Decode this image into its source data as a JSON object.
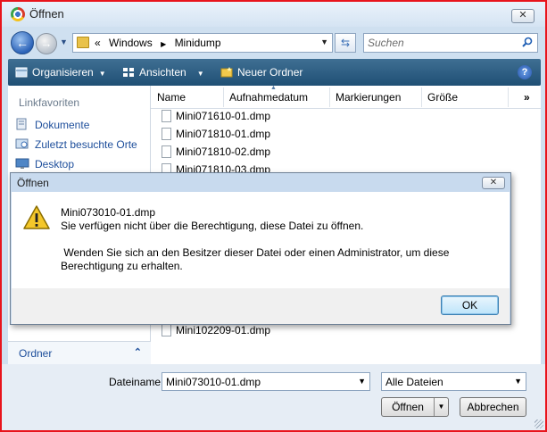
{
  "window": {
    "title": "Öffnen"
  },
  "nav": {
    "breadcrumb": [
      "«",
      "Windows",
      "Minidump"
    ],
    "search_placeholder": "Suchen"
  },
  "toolbar": {
    "organize": "Organisieren",
    "views": "Ansichten",
    "new_folder": "Neuer Ordner"
  },
  "sidebar": {
    "heading": "Linkfavoriten",
    "items": [
      {
        "label": "Dokumente"
      },
      {
        "label": "Zuletzt besuchte Orte"
      },
      {
        "label": "Desktop"
      }
    ],
    "folders_label": "Ordner"
  },
  "columns": [
    "Name",
    "Aufnahmedatum",
    "Markierungen",
    "Größe"
  ],
  "more_columns": "»",
  "files": [
    "Mini071610-01.dmp",
    "Mini071810-01.dmp",
    "Mini071810-02.dmp",
    "Mini071810-03.dmp",
    "Mini102209-01.dmp"
  ],
  "bottom": {
    "filename_label": "Dateiname:",
    "filename_value": "Mini073010-01.dmp",
    "filetype_value": "Alle Dateien",
    "open_label": "Öffnen",
    "cancel_label": "Abbrechen"
  },
  "dialog": {
    "title": "Öffnen",
    "filename": "Mini073010-01.dmp",
    "message_line1": "Sie verfügen nicht über die Berechtigung, diese Datei zu öffnen.",
    "message_line2": " Wenden Sie sich an den Besitzer dieser Datei oder einen Administrator, um diese",
    "message_line3": "Berechtigung zu erhalten.",
    "ok_label": "OK"
  },
  "colors": {
    "frame": "#e8141c",
    "toolbar": "#2f5f85",
    "link": "#1d4e9b"
  }
}
